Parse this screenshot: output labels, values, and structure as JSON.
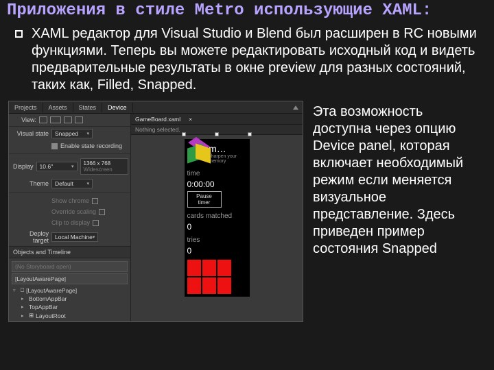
{
  "header": "Приложения в стиле Metro использующие XAML:",
  "bullet": "XAML редактор для Visual Studio и Blend был расширен в RC новыми функциями. Теперь вы можете редактировать исходный код и видеть предварительные результаты в окне preview для разных состояний, таких как, Filled, Snapped.",
  "side_text": "Эта возможность доступна через опцию Device panel, которая включает необходимый режим если меняется визуальное представление. Здесь приведен пример состояния Snapped",
  "ide": {
    "topTabs": [
      "Projects",
      "Assets",
      "States",
      "Device"
    ],
    "viewLabel": "View:",
    "props": {
      "visualState": {
        "label": "Visual state",
        "value": "Snapped"
      },
      "enableRec": "Enable state recording",
      "display": {
        "label": "Display",
        "size": "10.6\"",
        "res": "1366 x 768",
        "note": "Widescreen"
      },
      "theme": {
        "label": "Theme",
        "value": "Default"
      },
      "showChrome": "Show chrome",
      "overrideScaling": "Override scaling",
      "clipToDisplay": "Clip to display",
      "deployTarget": {
        "label": "Deploy target",
        "value": "Local Machine"
      }
    },
    "objectsHeader": "Objects and Timeline",
    "storyboard": "(No Storyboard open)",
    "rootItem": "[LayoutAwarePage]",
    "tree": [
      "[LayoutAwarePage]",
      "BottomAppBar",
      "TopAppBar",
      "LayoutRoot"
    ],
    "docTab": "GameBoard.xaml",
    "selBar": "Nothing selected."
  },
  "phone": {
    "title": "m…",
    "subtitle": "sharpen your memory",
    "timeLabel": "time",
    "timeValue": "0:00:00",
    "pauseBtn": "Pause timer",
    "cardsLabel": "cards matched",
    "cardsValue": "0",
    "triesLabel": "tries",
    "triesValue": "0"
  }
}
